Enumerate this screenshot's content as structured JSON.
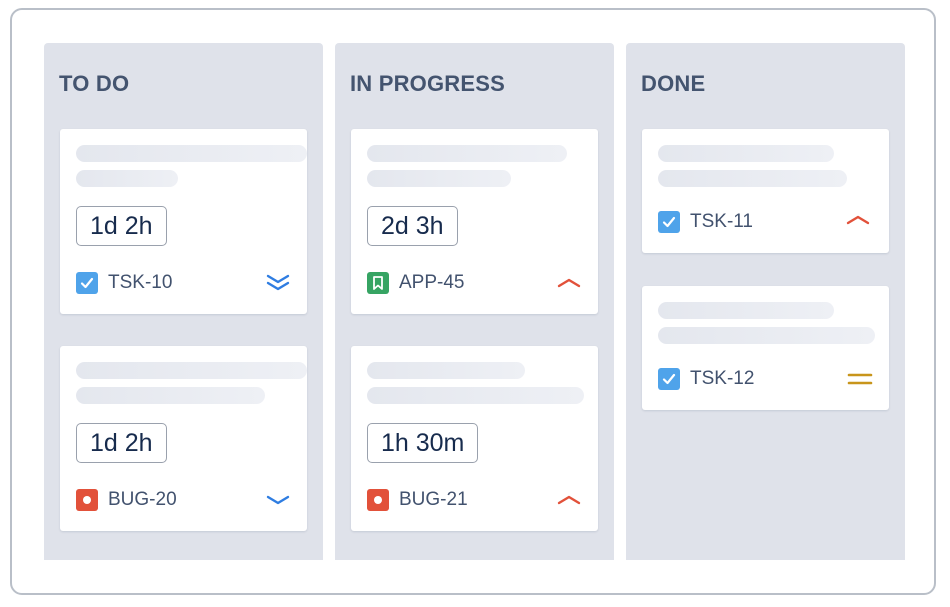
{
  "board": {
    "columns": [
      {
        "title": "TO DO",
        "cards": [
          {
            "estimate": "1d 2h",
            "key": "TSK-10",
            "type": "task",
            "priority": "lowest",
            "priority_icon": "double-chevron-down-icon"
          },
          {
            "estimate": "1d 2h",
            "key": "BUG-20",
            "type": "bug",
            "priority": "low",
            "priority_icon": "chevron-down-icon"
          }
        ]
      },
      {
        "title": "IN PROGRESS",
        "cards": [
          {
            "estimate": "2d 3h",
            "key": "APP-45",
            "type": "story",
            "priority": "high",
            "priority_icon": "chevron-up-icon"
          },
          {
            "estimate": "1h 30m",
            "key": "BUG-21",
            "type": "bug",
            "priority": "high",
            "priority_icon": "chevron-up-icon"
          }
        ]
      },
      {
        "title": "DONE",
        "cards": [
          {
            "key": "TSK-11",
            "type": "task",
            "priority": "high",
            "priority_icon": "chevron-up-icon"
          },
          {
            "key": "TSK-12",
            "type": "task",
            "priority": "medium",
            "priority_icon": "equals-icon"
          }
        ]
      }
    ]
  },
  "colors": {
    "column_bg": "#dfe2ea",
    "task": "#4fa3ea",
    "story": "#36a463",
    "bug": "#e2513a",
    "priority_low": "#2f7de1",
    "priority_high": "#e2513a",
    "priority_medium": "#c8951b"
  }
}
